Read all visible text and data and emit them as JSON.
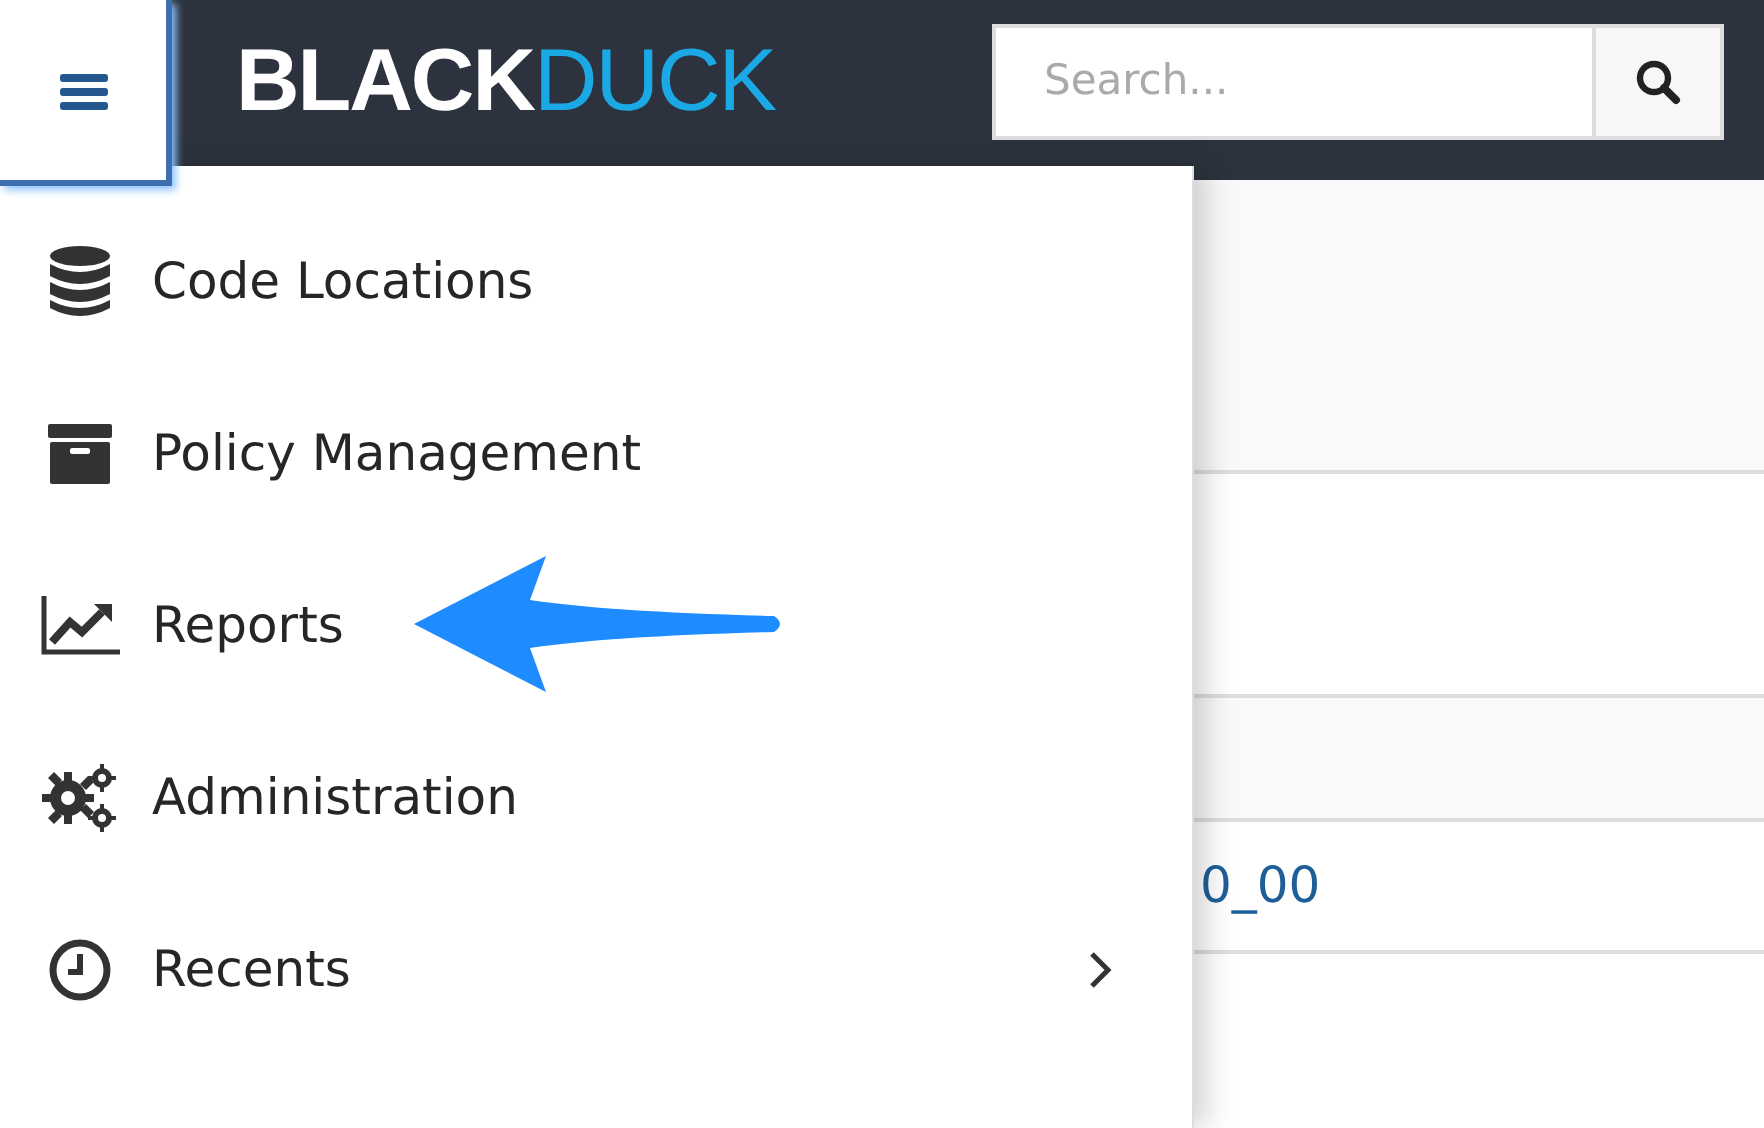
{
  "header": {
    "logo": {
      "first": "BLACK",
      "second": "DUCK"
    },
    "search": {
      "placeholder": "Search..."
    }
  },
  "menu": {
    "items": [
      {
        "label": "Code Locations",
        "has_submenu": false
      },
      {
        "label": "Policy Management",
        "has_submenu": false
      },
      {
        "label": "Reports",
        "has_submenu": false
      },
      {
        "label": "Administration",
        "has_submenu": false
      },
      {
        "label": "Recents",
        "has_submenu": true
      }
    ]
  },
  "background_table": {
    "visible_cell": "0_00"
  }
}
